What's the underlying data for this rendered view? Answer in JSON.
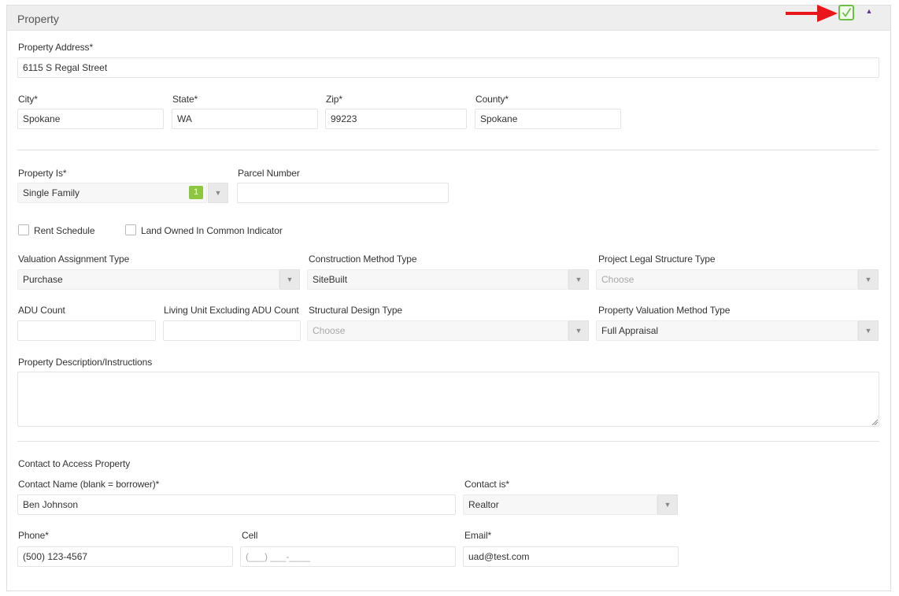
{
  "panel": {
    "title": "Property"
  },
  "labels": {
    "address": "Property Address*",
    "city": "City*",
    "state": "State*",
    "zip": "Zip*",
    "county": "County*",
    "property_is": "Property Is*",
    "parcel": "Parcel Number",
    "rent_schedule": "Rent Schedule",
    "land_owned": "Land Owned In Common Indicator",
    "valuation_assignment": "Valuation Assignment Type",
    "construction_method": "Construction Method Type",
    "project_legal": "Project Legal Structure Type",
    "adu_count": "ADU Count",
    "living_unit": "Living Unit Excluding ADU Count",
    "structural_design": "Structural Design Type",
    "valuation_method": "Property Valuation Method Type",
    "description": "Property Description/Instructions",
    "contact_section": "Contact to Access Property",
    "contact_name": "Contact Name (blank = borrower)*",
    "contact_is": "Contact is*",
    "phone": "Phone*",
    "cell": "Cell",
    "email": "Email*"
  },
  "values": {
    "address": "6115 S Regal Street",
    "city": "Spokane",
    "state": "WA",
    "zip": "99223",
    "county": "Spokane",
    "property_is": "Single Family",
    "property_is_badge": "1",
    "parcel": "",
    "valuation_assignment": "Purchase",
    "construction_method": "SiteBuilt",
    "project_legal": "Choose",
    "adu_count": "",
    "living_unit": "",
    "structural_design": "Choose",
    "valuation_method": "Full Appraisal",
    "description": "",
    "contact_name": "Ben Johnson",
    "contact_is": "Realtor",
    "phone": "(500) 123-4567",
    "cell": "(___) ___-____",
    "email": "uad@test.com"
  },
  "checkboxes": {
    "rent_schedule": false,
    "land_owned": false
  },
  "icons": {
    "arrow": "red-arrow-icon",
    "check": "check-icon",
    "collapse": "caret-up-icon",
    "dropdown": "caret-down-icon"
  },
  "colors": {
    "accent_green": "#8dc63f",
    "arrow_red": "#e8161b",
    "collapse_purple": "#6a2fa0"
  }
}
